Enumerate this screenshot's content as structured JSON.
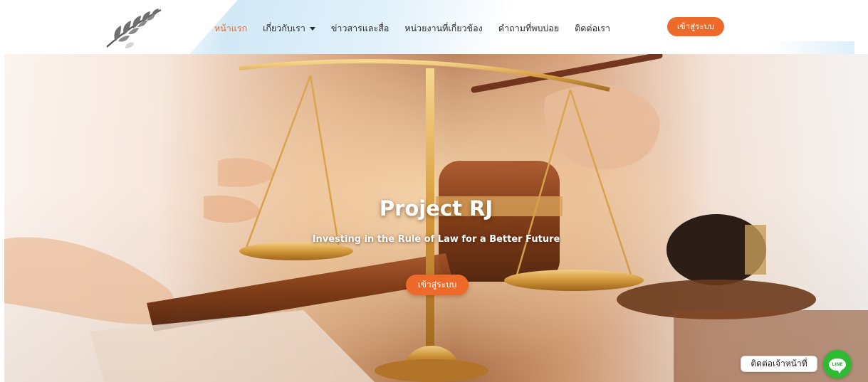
{
  "header": {
    "logo_icon": "laurel-branch-icon",
    "nav": [
      {
        "label": "หน้าแรก",
        "active": true
      },
      {
        "label": "เกี่ยวกับเรา",
        "has_dropdown": true
      },
      {
        "label": "ข่าวสารและสื่อ"
      },
      {
        "label": "หน่วยงานที่เกี่ยวข้อง"
      },
      {
        "label": "คำถามที่พบบ่อย"
      },
      {
        "label": "ติดต่อเรา"
      }
    ],
    "login_label": "เข้าสู่ระบบ"
  },
  "hero": {
    "title": "Project RJ",
    "subtitle": "Investing in the Rule of Law for a Better Future",
    "cta_label": "เข้าสู่ระบบ",
    "background": "justice-scales-and-gavel-photo"
  },
  "contact": {
    "label": "ติดต่อเจ้าหน้าที่",
    "line_icon": "line-chat-icon",
    "line_text": "LINE"
  },
  "colors": {
    "accent": "#ee6a2a",
    "line_green": "#2dbb32"
  }
}
